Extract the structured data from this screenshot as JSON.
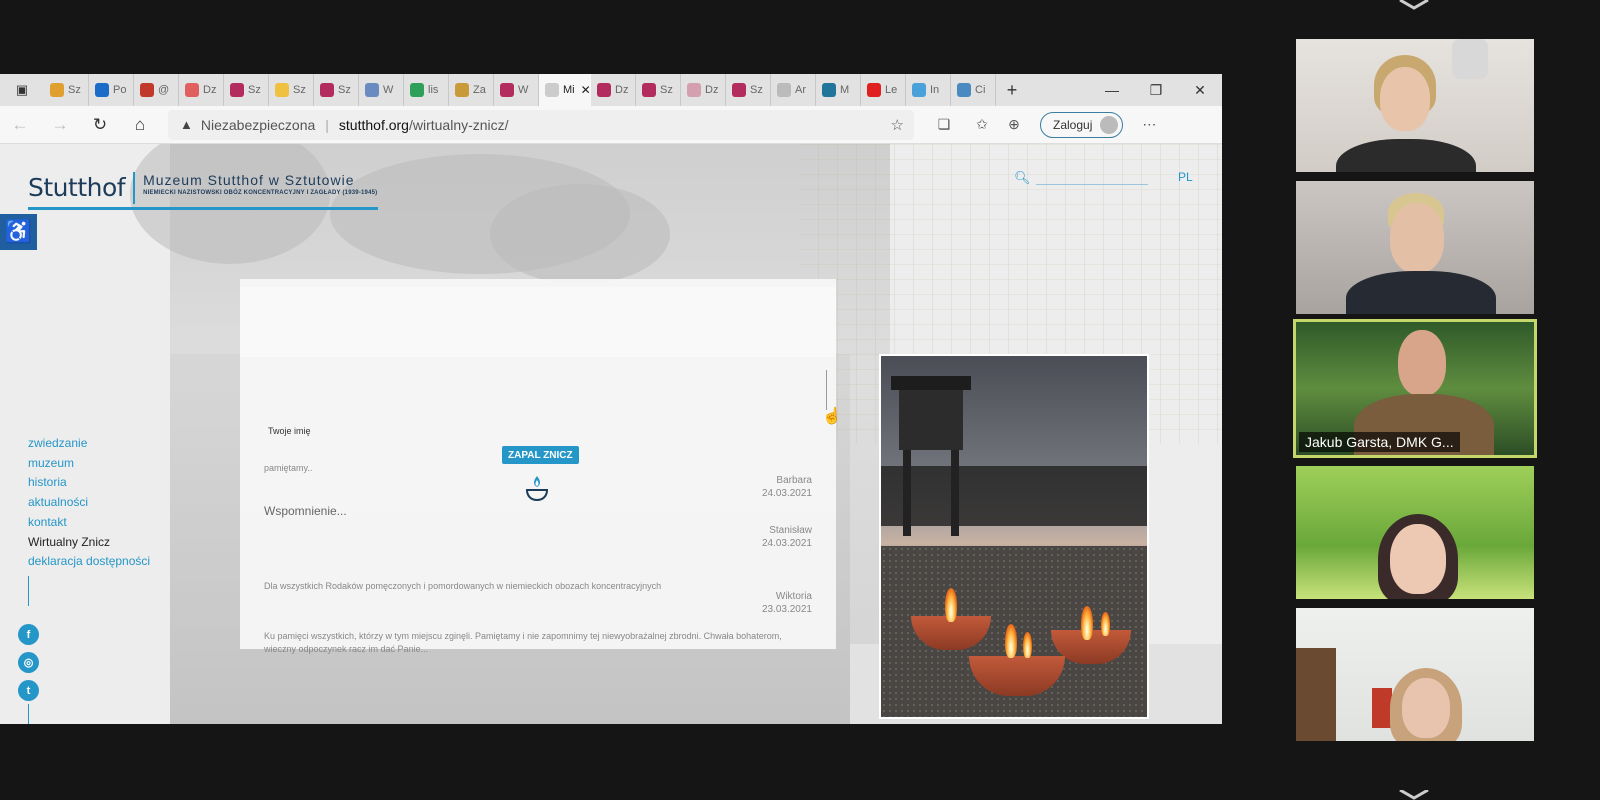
{
  "browser": {
    "tabs": [
      {
        "label": "Sz",
        "color": "#e0a030"
      },
      {
        "label": "Po",
        "color": "#1a6cc8"
      },
      {
        "label": "@",
        "color": "#c0392b"
      },
      {
        "label": "Dz",
        "color": "#e06060"
      },
      {
        "label": "Sz",
        "color": "#b22c5e"
      },
      {
        "label": "Sz",
        "color": "#f0c040"
      },
      {
        "label": "Sz",
        "color": "#b22c5e"
      },
      {
        "label": "W",
        "color": "#6a8bc0"
      },
      {
        "label": "lis",
        "color": "#2ea05a"
      },
      {
        "label": "Za",
        "color": "#c89a3a"
      },
      {
        "label": "W",
        "color": "#b22c5e"
      },
      {
        "label": "Mi",
        "color": "#cccccc",
        "active": true
      },
      {
        "label": "Dz",
        "color": "#b22c5e"
      },
      {
        "label": "Sz",
        "color": "#b22c5e"
      },
      {
        "label": "Dz",
        "color": "#d4a0b0"
      },
      {
        "label": "Sz",
        "color": "#b22c5e"
      },
      {
        "label": "Ar",
        "color": "#bbbbbb"
      },
      {
        "label": "M",
        "color": "#21759b"
      },
      {
        "label": "Le",
        "color": "#e02020"
      },
      {
        "label": "In",
        "color": "#4aa0d8"
      },
      {
        "label": "Ci",
        "color": "#4a8ac0"
      }
    ],
    "address": {
      "security": "Niezabezpieczona",
      "host": "stutthof.org",
      "path": "/wirtualny-znicz/"
    },
    "login_label": "Zaloguj",
    "icons": [
      "back-icon",
      "forward-icon",
      "reload-icon",
      "home-icon",
      "warning-icon",
      "favorite-add-icon",
      "collections-icon",
      "favorites-icon",
      "profile-icon",
      "more-icon"
    ]
  },
  "site": {
    "logo_word": "Stutthof",
    "logo_title": "Muzeum Stutthof w Sztutowie",
    "logo_subtitle": "NIEMIECKI NAZISTOWSKI OBÓZ KONCENTRACYJNY I ZAGŁADY (1939-1945)",
    "lang": "PL",
    "menu": [
      {
        "label": "zwiedzanie",
        "current": false
      },
      {
        "label": "muzeum",
        "current": false
      },
      {
        "label": "historia",
        "current": false
      },
      {
        "label": "aktualności",
        "current": false
      },
      {
        "label": "kontakt",
        "current": false
      },
      {
        "label": "Wirtualny Znicz",
        "current": true
      },
      {
        "label": "deklaracja dostępności",
        "current": false
      }
    ],
    "social": [
      "facebook-icon",
      "instagram-icon",
      "twitter-icon"
    ],
    "form": {
      "name_label": "Twoje imię",
      "button": "ZAPAL ZNICZ",
      "heading": "Wspomnienie..."
    },
    "entries": [
      {
        "text": "pamiętamy..",
        "author": "Barbara",
        "date": "24.03.2021"
      },
      {
        "text": "Dla wszystkich Rodaków pomęczonych i pomordowanych w niemieckich obozach koncentracyjnych",
        "author": "Stanisław",
        "date": "24.03.2021"
      },
      {
        "text": "Ku pamięci wszystkich, którzy w tym miejscu zginęli. Pamiętamy i nie zapomnimy tej niewyobrażalnej zbrodni. Chwała bohaterom, wieczny odpoczynek racz im dać Panie...",
        "author": "Wiktoria",
        "date": "23.03.2021"
      }
    ]
  },
  "participants": [
    {
      "name": "",
      "speaking": false
    },
    {
      "name": "",
      "speaking": false
    },
    {
      "name": "Jakub Garsta, DMK G...",
      "speaking": true
    },
    {
      "name": "",
      "speaking": false
    },
    {
      "name": "",
      "speaking": false
    }
  ],
  "colors": {
    "accent": "#2596c8",
    "speaking_border": "#c3d76a",
    "meeting_bg": "#151515"
  }
}
